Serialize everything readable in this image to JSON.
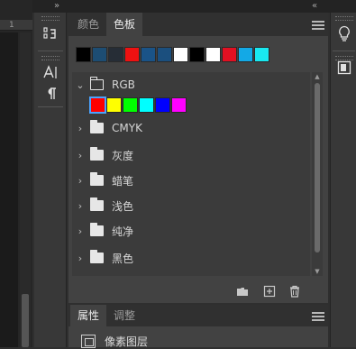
{
  "collapse_glyph": "«",
  "expand_glyph": "»",
  "doc_ruler_tick": "1",
  "tools": [
    {
      "name": "character-tool",
      "icon": "text-icon"
    },
    {
      "name": "paragraph-tool",
      "icon": "paragraph-icon"
    }
  ],
  "swatch_panel": {
    "tabs": [
      {
        "label": "颜色",
        "active": false
      },
      {
        "label": "色板",
        "active": true
      }
    ],
    "recent_colors": [
      "#000000",
      "#1d4d73",
      "#262d36",
      "#ee1111",
      "#1a5387",
      "#1b4f7e",
      "#ffffff",
      "#000000",
      "#ffffff",
      "#e21022",
      "#13a9e6",
      "#19e8f0"
    ],
    "groups": [
      {
        "label": "RGB",
        "expanded": true,
        "chevron": "⌄"
      },
      {
        "label": "CMYK",
        "expanded": false,
        "chevron": "›"
      },
      {
        "label": "灰度",
        "expanded": false,
        "chevron": "›"
      },
      {
        "label": "蜡笔",
        "expanded": false,
        "chevron": "›"
      },
      {
        "label": "浅色",
        "expanded": false,
        "chevron": "›"
      },
      {
        "label": "纯净",
        "expanded": false,
        "chevron": "›"
      },
      {
        "label": "黑色",
        "expanded": false,
        "chevron": "›"
      }
    ],
    "rgb_swatches": [
      "#ff0000",
      "#ffff00",
      "#00ff00",
      "#00ffff",
      "#0000ff",
      "#ff00ff"
    ],
    "selected_swatch": 0,
    "footer_icons": [
      "new-group-icon",
      "new-swatch-icon",
      "trash-icon"
    ]
  },
  "properties_panel": {
    "tabs": [
      {
        "label": "属性",
        "active": true
      },
      {
        "label": "调整",
        "active": false
      }
    ],
    "layer_type": "像素图层"
  },
  "right_icons": [
    "learn-icon",
    "libraries-icon"
  ],
  "colors": {
    "accent": "#4aa3ff",
    "panel_bg": "#424242",
    "tab_bar_bg": "#303030"
  }
}
